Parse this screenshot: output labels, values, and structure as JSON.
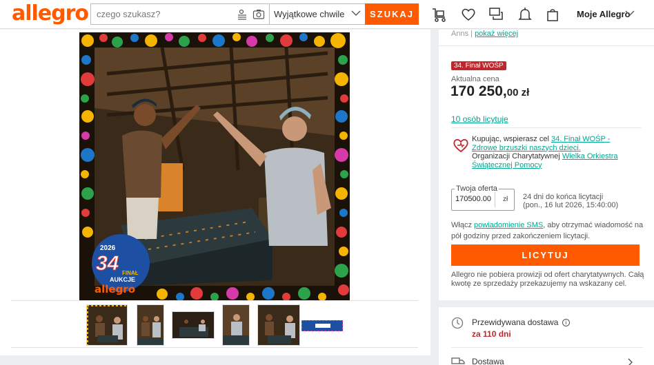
{
  "header": {
    "logo": "allegro",
    "search_placeholder": "czego szukasz?",
    "category": "Wyjątkowe chwile",
    "search_button": "SZUKAJ",
    "account": "Moje Allegro"
  },
  "gallery": {
    "badge": {
      "year": "2026",
      "number": "34",
      "sub": "FINAŁ",
      "aukcje": "AUKCJE",
      "brand": "allegro"
    },
    "thumbnail_count": 6
  },
  "offer": {
    "top_link_prefix": "Anns",
    "top_link": "pokaż więcej",
    "badge": "34. Finał WOŚP",
    "price_label": "Aktualna cena",
    "price_main": "170 250,",
    "price_cents": "00 zł",
    "bids_link": "10 osób licytuje",
    "charity": {
      "prefix": "Kupując, wspierasz cel ",
      "goal_link": "34. Finał WOŚP - Zdrowe brzuszki naszych dzieci.",
      "org_prefix": "Organizacji Charytatywnej ",
      "org_link": "Wielka Orkiestra Świątecznej Pomocy"
    },
    "your_offer_label": "Twoja oferta",
    "your_offer_value": "170500.00",
    "currency": "zł",
    "time_left": "24 dni do końca licytacji",
    "end_date": "(pon., 16 lut 2026, 15:40:00)",
    "sms": {
      "prefix": "Włącz ",
      "link": "powiadomienie SMS",
      "suffix": ", aby otrzymać wiadomość na pół godziny przed zakończeniem licytacji."
    },
    "bid_button": "LICYTUJ",
    "note": "Allegro nie pobiera prowizji od ofert charytatywnych. Całą kwotę ze sprzedaży przekazujemy na wskazany cel."
  },
  "delivery": {
    "title": "Przewidywana dostawa",
    "value": "za 110 dni",
    "shipping_label": "Dostawa"
  },
  "colors": {
    "accent": "#ff5a00",
    "link": "#00a790",
    "wosp_red": "#c0272d"
  }
}
